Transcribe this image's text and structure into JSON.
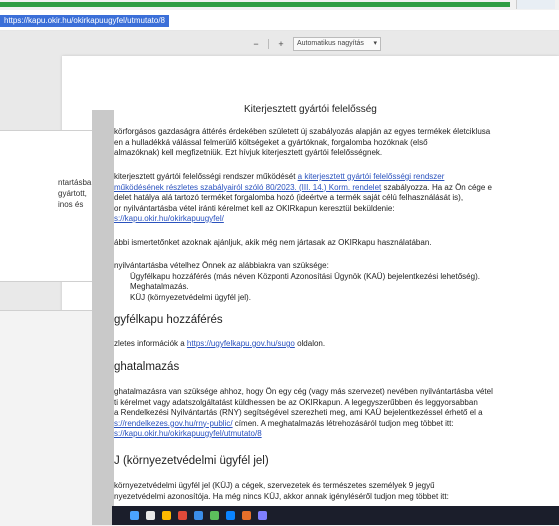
{
  "browser": {
    "url": "https://kapu.okir.hu/okirkapuugyfel/utmutato/8"
  },
  "toolbar": {
    "minus": "−",
    "plus": "+",
    "zoom_label": "Automatikus nagyítás"
  },
  "left_panel": {
    "lines": [
      "ntartásba",
      "gyártott,",
      "inos és"
    ]
  },
  "document": {
    "title": "Kiterjesztett gyártói felelősség",
    "p1": [
      "körforgásos gazdaságra áttérés érdekében született új szabályozás alapján az egyes termékek életciklusa",
      "en a hulladékká válással felmerülő költségeket a gyártóknak, forgalomba hozóknak (első",
      "almazóknak) kell megfizetniük. Ezt hívjuk kiterjesztett gyártói felelősségnek."
    ],
    "p2": {
      "line1_pre": "kiterjesztett gyártói felelősségi rendszer működését ",
      "line1_link": "a kiterjesztett gyártói felelősségi rendszer",
      "line2_link": "működésének részletes szabályairól szóló 80/2023. (III. 14.) Korm. rendelet",
      "line2_post": " szabályozza. Ha az Ön cége e",
      "line3": "delet hatálya alá tartozó terméket forgalomba hozó (ideértve a termék saját célú felhasználását is),",
      "line4": "or nyilvántartásba vétel iránti kérelmet kell az OKIRkapun keresztül beküldenie:",
      "line5_link": "s://kapu.okir.hu/okirkapuugyfel/"
    },
    "p3": "ábbi ismertetőnket azoknak ajánljuk, akik még nem jártasak az OKIRkapu használatában.",
    "p4": {
      "intro": "nyilvántartásba vételhez Önnek az alábbiakra van szüksége:",
      "items": [
        "Ügyfélkapu hozzáférés (más néven Központi Azonosítási Ügynök (KAÜ) bejelentkezési lehetőség).",
        "Meghatalmazás.",
        "KÜJ (környezetvédelmi ügyfél jel)."
      ]
    },
    "h_ugyfelkapu": "gyfélkapu hozzáférés",
    "p5": {
      "pre": "zletes információk a ",
      "link": "https://ugyfelkapu.gov.hu/sugo",
      "post": " oldalon."
    },
    "h_meghatalmazas": "ghatalmazás",
    "p6": {
      "line1": "ghatalmazásra van szüksége ahhoz, hogy Ön egy cég (vagy más szervezet) nevében nyilvántartásba vétel",
      "line2": "ti kérelmet vagy adatszolgáltatást küldhessen be az OKIRkapun. A legegyszerűbben és leggyorsabban",
      "line3": "a Rendelkezési Nyilvántartás (RNY) segítségével szerezheti meg, ami KAÜ bejelentkezéssel érhető el a",
      "line4_link": "s://rendelkezes.gov.hu/rny-public/",
      "line4_post": " címen. A meghatalmazás létrehozásáról tudjon meg többet itt:",
      "line5_link": "s://kapu.okir.hu/okirkapuugyfel/utmutato/8"
    },
    "h_kuj": "J (környezetvédelmi ügyfél jel)",
    "p7": {
      "line1": "környezetvédelmi ügyfél jel (KÜJ) a cégek, szervezetek és természetes személyek 9 jegyű",
      "line2": "nyezetvédelmi azonosítója. Ha még nincs KÜJ, akkor annak igényléséről tudjon meg többet itt:"
    }
  },
  "taskbar": {
    "icon_colors": [
      "#4aa3ff",
      "#e8e8e8",
      "#ffb900",
      "#e04a3a",
      "#3b8eea",
      "#5cc05c",
      "#0a84ff",
      "#e8702a",
      "#7f7fff"
    ]
  }
}
